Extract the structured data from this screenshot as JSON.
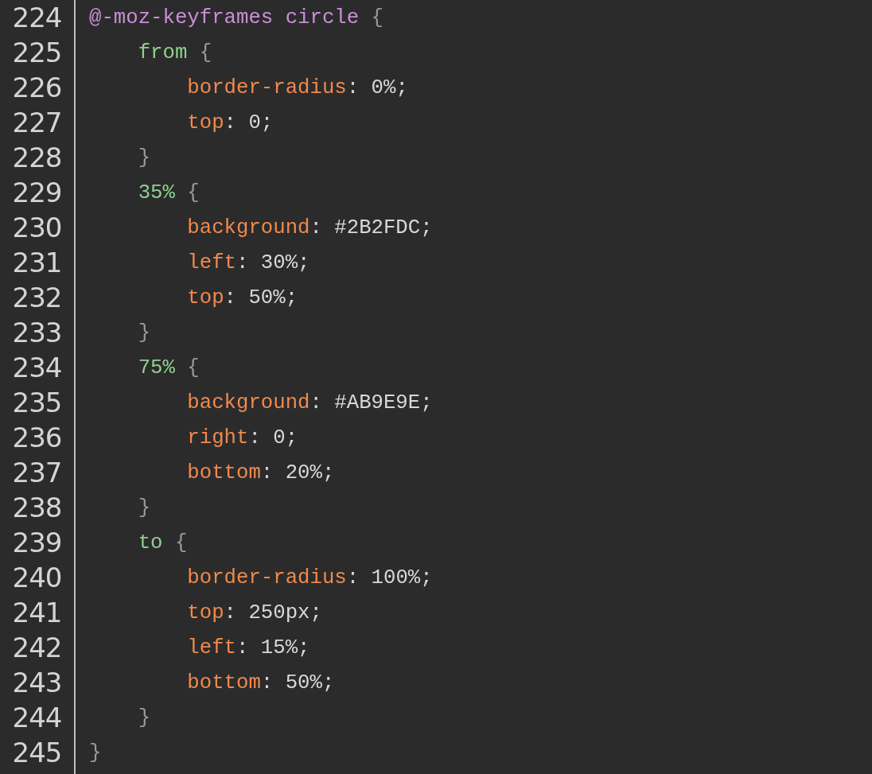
{
  "editor": {
    "lines": [
      {
        "number": "224",
        "tokens": [
          {
            "text": "@-moz-keyframes circle",
            "kind": "at-rule"
          },
          {
            "text": " {",
            "kind": "brace"
          }
        ],
        "children": [
          {
            "number": "225",
            "tokens": [
              {
                "text": "from",
                "kind": "selector"
              },
              {
                "text": " {",
                "kind": "brace"
              }
            ],
            "children": [
              {
                "number": "226",
                "tokens": [
                  {
                    "text": "border-radius",
                    "kind": "property"
                  },
                  {
                    "text": ": 0%;",
                    "kind": "value"
                  }
                ]
              },
              {
                "number": "227",
                "tokens": [
                  {
                    "text": "top",
                    "kind": "property"
                  },
                  {
                    "text": ": 0;",
                    "kind": "value"
                  }
                ]
              }
            ]
          },
          {
            "number": "228",
            "tokens": [
              {
                "text": "}",
                "kind": "brace"
              }
            ]
          },
          {
            "number": "229",
            "tokens": [
              {
                "text": "35%",
                "kind": "selector"
              },
              {
                "text": " {",
                "kind": "brace"
              }
            ],
            "children": [
              {
                "number": "230",
                "tokens": [
                  {
                    "text": "background",
                    "kind": "property"
                  },
                  {
                    "text": ": #2B2FDC;",
                    "kind": "value"
                  }
                ]
              },
              {
                "number": "231",
                "tokens": [
                  {
                    "text": "left",
                    "kind": "property"
                  },
                  {
                    "text": ": 30%;",
                    "kind": "value"
                  }
                ]
              },
              {
                "number": "232",
                "tokens": [
                  {
                    "text": "top",
                    "kind": "property"
                  },
                  {
                    "text": ": 50%;",
                    "kind": "value"
                  }
                ]
              }
            ]
          },
          {
            "number": "233",
            "tokens": [
              {
                "text": "}",
                "kind": "brace"
              }
            ]
          },
          {
            "number": "234",
            "tokens": [
              {
                "text": "75%",
                "kind": "selector"
              },
              {
                "text": " {",
                "kind": "brace"
              }
            ],
            "children": [
              {
                "number": "235",
                "tokens": [
                  {
                    "text": "background",
                    "kind": "property"
                  },
                  {
                    "text": ": #AB9E9E;",
                    "kind": "value"
                  }
                ]
              },
              {
                "number": "236",
                "tokens": [
                  {
                    "text": "right",
                    "kind": "property"
                  },
                  {
                    "text": ": 0;",
                    "kind": "value"
                  }
                ]
              },
              {
                "number": "237",
                "tokens": [
                  {
                    "text": "bottom",
                    "kind": "property"
                  },
                  {
                    "text": ": 20%;",
                    "kind": "value"
                  }
                ]
              }
            ]
          },
          {
            "number": "238",
            "tokens": [
              {
                "text": "}",
                "kind": "brace"
              }
            ]
          },
          {
            "number": "239",
            "tokens": [
              {
                "text": "to",
                "kind": "selector"
              },
              {
                "text": " {",
                "kind": "brace"
              }
            ],
            "children": [
              {
                "number": "240",
                "tokens": [
                  {
                    "text": "border-radius",
                    "kind": "property"
                  },
                  {
                    "text": ": 100%;",
                    "kind": "value"
                  }
                ]
              },
              {
                "number": "241",
                "tokens": [
                  {
                    "text": "top",
                    "kind": "property"
                  },
                  {
                    "text": ": 250px;",
                    "kind": "value"
                  }
                ]
              },
              {
                "number": "242",
                "tokens": [
                  {
                    "text": "left",
                    "kind": "property"
                  },
                  {
                    "text": ": 15%;",
                    "kind": "value"
                  }
                ]
              },
              {
                "number": "243",
                "tokens": [
                  {
                    "text": "bottom",
                    "kind": "property"
                  },
                  {
                    "text": ": 50%;",
                    "kind": "value"
                  }
                ]
              }
            ]
          },
          {
            "number": "244",
            "tokens": [
              {
                "text": "}",
                "kind": "brace"
              }
            ]
          }
        ]
      },
      {
        "number": "245",
        "tokens": [
          {
            "text": "}",
            "kind": "brace"
          }
        ]
      }
    ]
  }
}
